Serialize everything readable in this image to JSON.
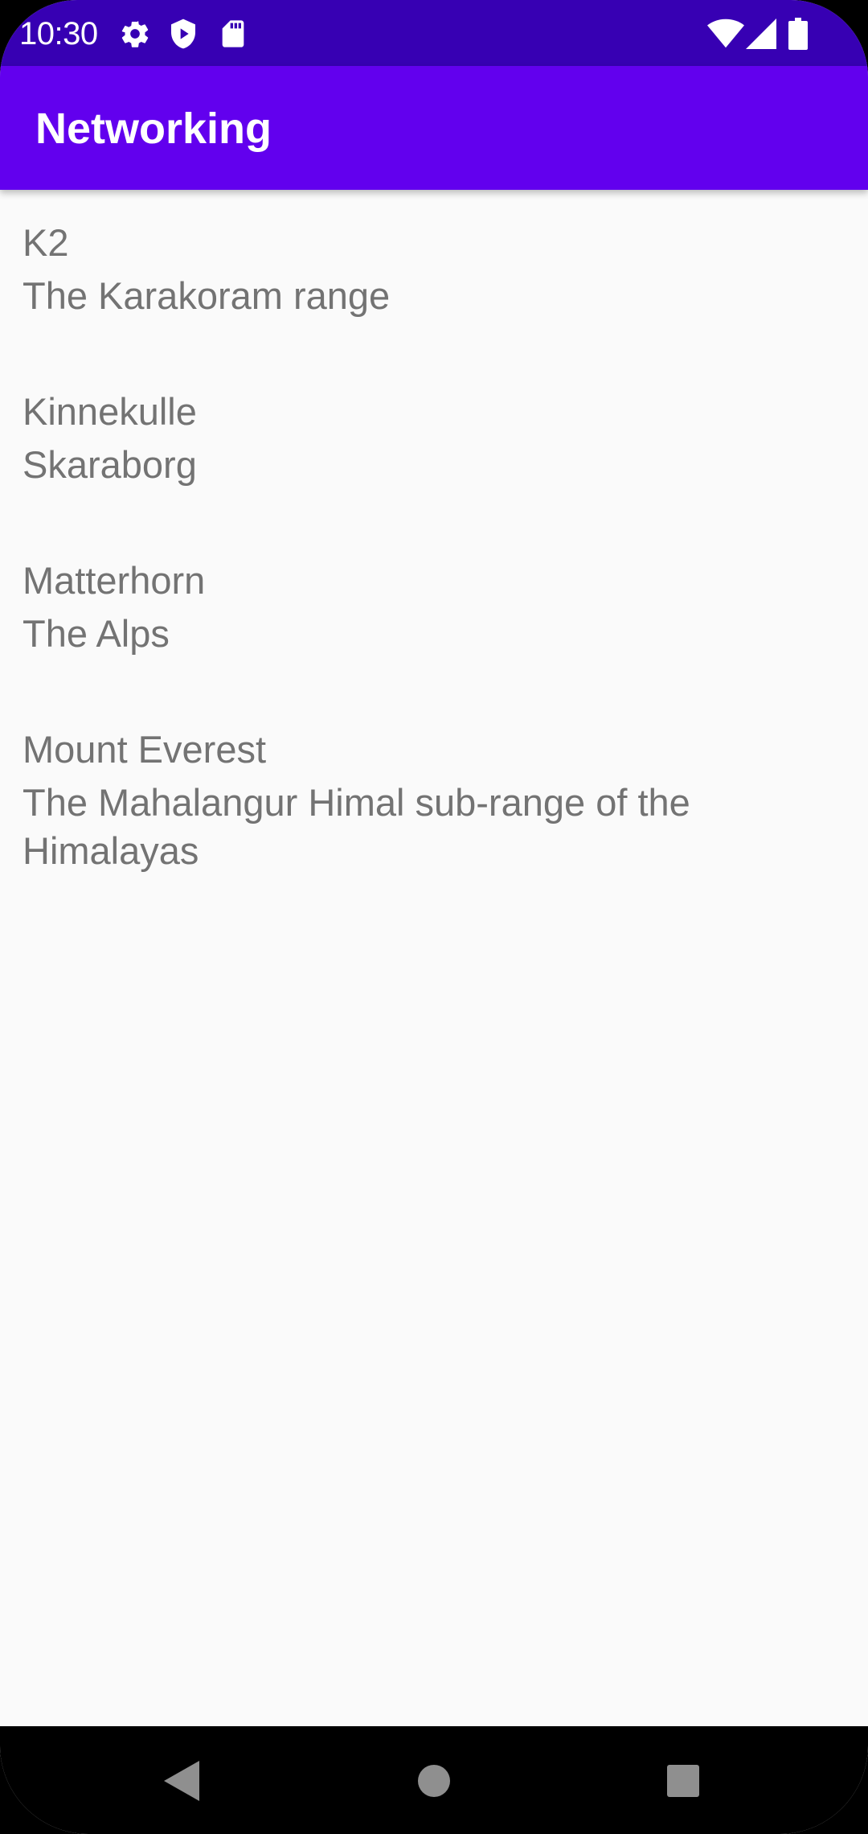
{
  "status_bar": {
    "time": "10:30",
    "left_icons": [
      "gear-icon",
      "shield-play-icon",
      "sd-card-icon"
    ],
    "right_icons": [
      "wifi-icon",
      "cell-signal-icon",
      "battery-icon"
    ]
  },
  "app_bar": {
    "title": "Networking",
    "color": "#6200ee",
    "status_color": "#3700b3"
  },
  "mountains": [
    {
      "name": "K2",
      "location": "The Karakoram range"
    },
    {
      "name": "Kinnekulle",
      "location": "Skaraborg"
    },
    {
      "name": "Matterhorn",
      "location": "The Alps"
    },
    {
      "name": "Mount Everest",
      "location": "The Mahalangur Himal sub-range of the Himalayas"
    }
  ],
  "nav_bar": {
    "buttons": [
      "back-icon",
      "home-icon",
      "recents-icon"
    ]
  }
}
